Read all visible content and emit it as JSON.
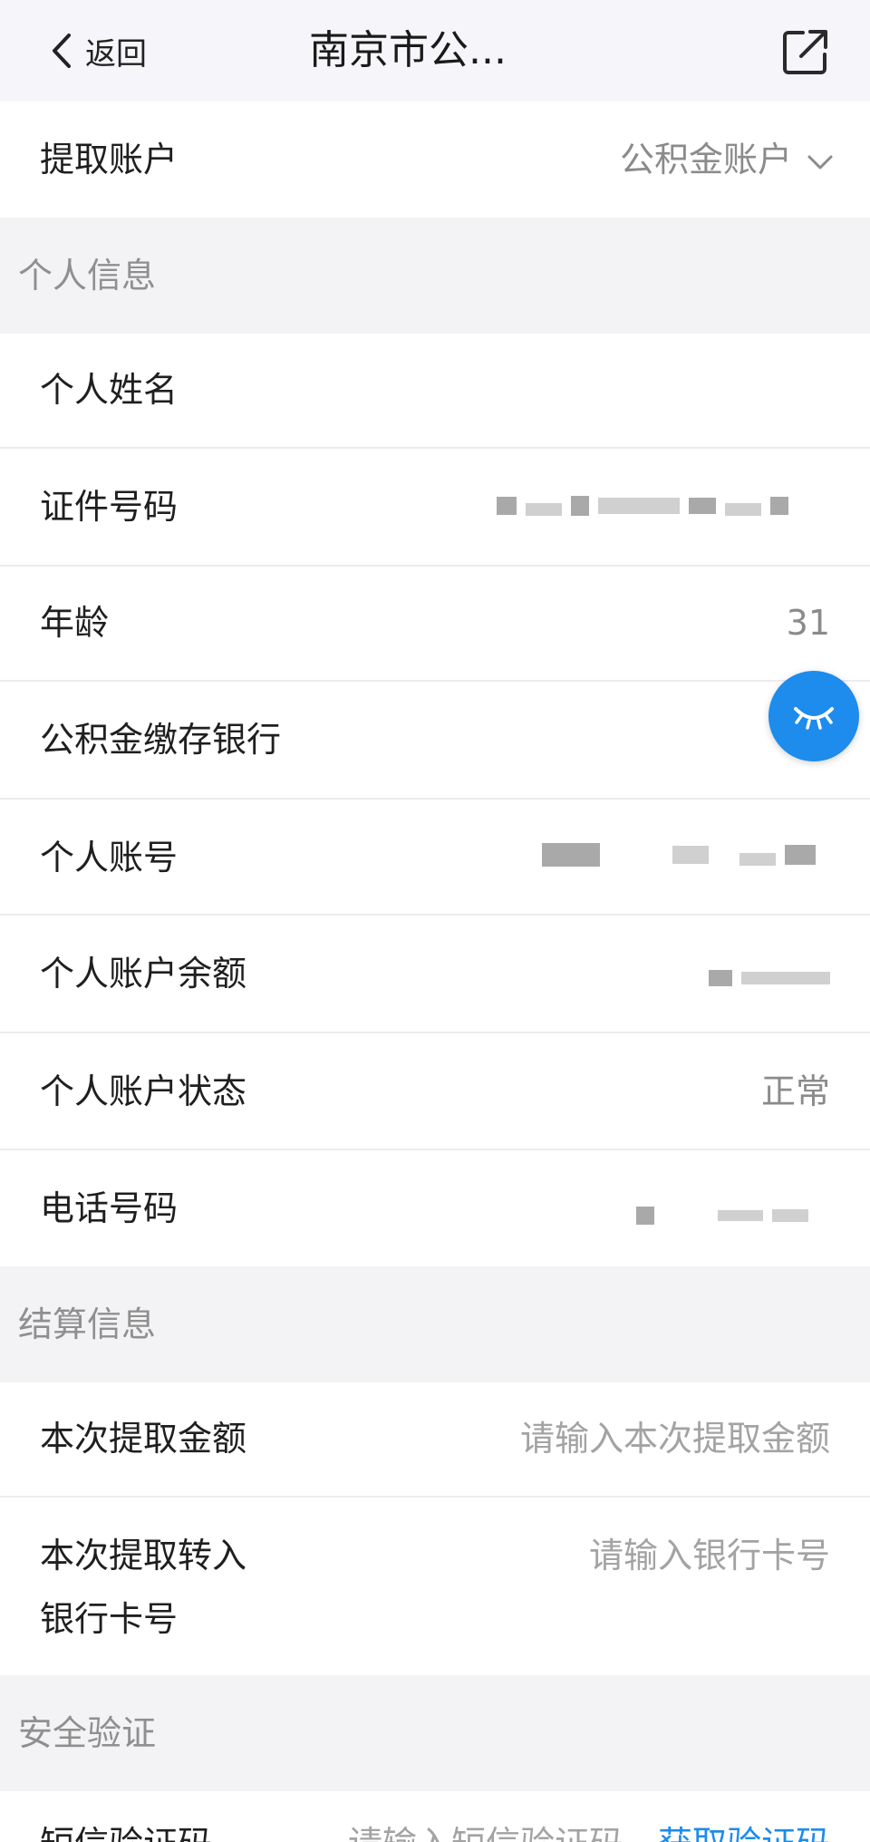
{
  "nav": {
    "back_label": "返回",
    "title": "南京市公...",
    "back_icon": "chevron-left-icon",
    "share_icon": "external-link-icon"
  },
  "account_select": {
    "label": "提取账户",
    "value": "公积金账户",
    "icon": "chevron-down-icon"
  },
  "personal": {
    "section_title": "个人信息",
    "name_label": "个人姓名",
    "id_label": "证件号码",
    "age_label": "年龄",
    "age_value": "31",
    "bank_label": "公积金缴存银行",
    "account_label": "个人账号",
    "balance_label": "个人账户余额",
    "status_label": "个人账户状态",
    "status_value": "正常",
    "phone_label": "电话号码"
  },
  "settlement": {
    "section_title": "结算信息",
    "amount_label": "本次提取金额",
    "amount_placeholder": "请输入本次提取金额",
    "card_label_line1": "本次提取转入",
    "card_label_line2": "银行卡号",
    "card_placeholder": "请输入银行卡号"
  },
  "security": {
    "section_title": "安全验证",
    "sms_label": "短信验证码",
    "sms_placeholder": "请输入短信验证码",
    "get_code_label": "获取验证码"
  },
  "floating": {
    "icon": "eye-closed-icon",
    "color": "#1d8cec"
  }
}
